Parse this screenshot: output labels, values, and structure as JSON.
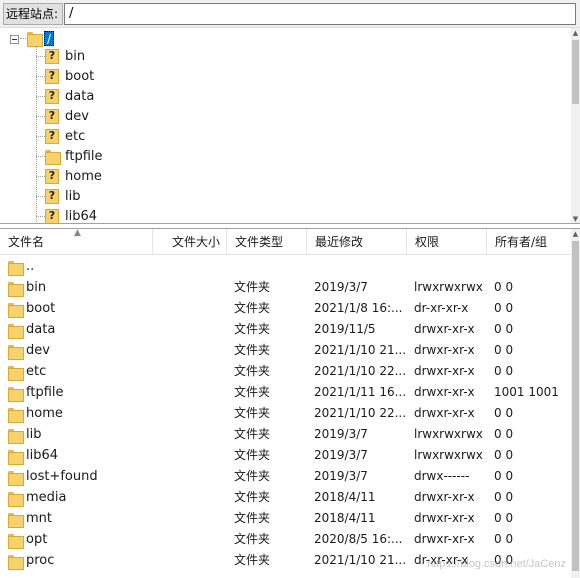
{
  "address_bar": {
    "label": "远程站点:",
    "path": "/"
  },
  "tree": {
    "root": "/",
    "items": [
      {
        "name": "bin",
        "icon": "folder-question-icon"
      },
      {
        "name": "boot",
        "icon": "folder-question-icon"
      },
      {
        "name": "data",
        "icon": "folder-question-icon"
      },
      {
        "name": "dev",
        "icon": "folder-question-icon"
      },
      {
        "name": "etc",
        "icon": "folder-question-icon"
      },
      {
        "name": "ftpfile",
        "icon": "folder-icon"
      },
      {
        "name": "home",
        "icon": "folder-question-icon"
      },
      {
        "name": "lib",
        "icon": "folder-question-icon"
      },
      {
        "name": "lib64",
        "icon": "folder-question-icon"
      }
    ]
  },
  "list": {
    "columns": [
      "文件名",
      "文件大小",
      "文件类型",
      "最近修改",
      "权限",
      "所有者/组"
    ],
    "rows": [
      {
        "name": "..",
        "type": "",
        "modified": "",
        "perm": "",
        "owner": "",
        "link": false
      },
      {
        "name": "bin",
        "type": "文件夹",
        "modified": "2019/3/7",
        "perm": "lrwxrwxrwx",
        "owner": "0 0",
        "link": true
      },
      {
        "name": "boot",
        "type": "文件夹",
        "modified": "2021/1/8 16:...",
        "perm": "dr-xr-xr-x",
        "owner": "0 0",
        "link": false
      },
      {
        "name": "data",
        "type": "文件夹",
        "modified": "2019/11/5",
        "perm": "drwxr-xr-x",
        "owner": "0 0",
        "link": false
      },
      {
        "name": "dev",
        "type": "文件夹",
        "modified": "2021/1/10 21...",
        "perm": "drwxr-xr-x",
        "owner": "0 0",
        "link": false
      },
      {
        "name": "etc",
        "type": "文件夹",
        "modified": "2021/1/10 22...",
        "perm": "drwxr-xr-x",
        "owner": "0 0",
        "link": false
      },
      {
        "name": "ftpfile",
        "type": "文件夹",
        "modified": "2021/1/11 16...",
        "perm": "drwxr-xr-x",
        "owner": "1001 1001",
        "link": false
      },
      {
        "name": "home",
        "type": "文件夹",
        "modified": "2021/1/10 22...",
        "perm": "drwxr-xr-x",
        "owner": "0 0",
        "link": false
      },
      {
        "name": "lib",
        "type": "文件夹",
        "modified": "2019/3/7",
        "perm": "lrwxrwxrwx",
        "owner": "0 0",
        "link": true
      },
      {
        "name": "lib64",
        "type": "文件夹",
        "modified": "2019/3/7",
        "perm": "lrwxrwxrwx",
        "owner": "0 0",
        "link": true
      },
      {
        "name": "lost+found",
        "type": "文件夹",
        "modified": "2019/3/7",
        "perm": "drwx------",
        "owner": "0 0",
        "link": false
      },
      {
        "name": "media",
        "type": "文件夹",
        "modified": "2018/4/11",
        "perm": "drwxr-xr-x",
        "owner": "0 0",
        "link": false
      },
      {
        "name": "mnt",
        "type": "文件夹",
        "modified": "2018/4/11",
        "perm": "drwxr-xr-x",
        "owner": "0 0",
        "link": false
      },
      {
        "name": "opt",
        "type": "文件夹",
        "modified": "2020/8/5 16:...",
        "perm": "drwxr-xr-x",
        "owner": "0 0",
        "link": false
      },
      {
        "name": "proc",
        "type": "文件夹",
        "modified": "2021/1/10 21...",
        "perm": "dr-xr-xr-x",
        "owner": "0 0",
        "link": false
      }
    ]
  },
  "watermark": "https://blog.csdn.net/JaCenz",
  "colors": {
    "selection": "#0078d7",
    "folder": "#f7d26b",
    "folder_border": "#d9a83a"
  }
}
